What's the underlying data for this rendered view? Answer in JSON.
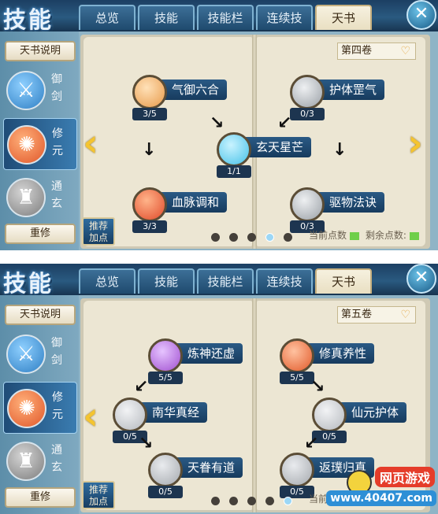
{
  "panels": [
    {
      "logo": "技能",
      "tabs": [
        "总览",
        "技能",
        "技能栏",
        "连续技",
        "天书"
      ],
      "active_tab": 4,
      "close_icon": "close-x-icon",
      "tianshu_button": "天书说明",
      "schools": [
        {
          "name": "御剑",
          "icon": "sword-emblem-icon",
          "color": "#2f7fc4"
        },
        {
          "name": "修元",
          "icon": "flame-emblem-icon",
          "color": "#e0572a"
        },
        {
          "name": "通玄",
          "icon": "pillar-emblem-icon",
          "color": "#7d7d7d"
        }
      ],
      "selected_school": 1,
      "reset_button": "重修",
      "recommend_button": [
        "推荐",
        "加点"
      ],
      "volume": "第四卷",
      "skills": [
        {
          "name": "气御六合",
          "level": "3/5",
          "color": "#e89a4a"
        },
        {
          "name": "护体罡气",
          "level": "0/3",
          "color": "#9aa0a6"
        },
        {
          "name": "玄天星芒",
          "level": "1/1",
          "color": "#45c1e8"
        },
        {
          "name": "血脉调和",
          "level": "3/3",
          "color": "#e04a2a"
        },
        {
          "name": "驱物法诀",
          "level": "0/3",
          "color": "#9aa0a6"
        }
      ],
      "pages": 5,
      "current_page": 3,
      "current_points_label": "当前点数",
      "remaining_points_label": "剩余点数:"
    },
    {
      "logo": "技能",
      "tabs": [
        "总览",
        "技能",
        "技能栏",
        "连续技",
        "天书"
      ],
      "active_tab": 4,
      "close_icon": "close-x-icon",
      "tianshu_button": "天书说明",
      "schools": [
        {
          "name": "御剑",
          "icon": "sword-emblem-icon",
          "color": "#2f7fc4"
        },
        {
          "name": "修元",
          "icon": "flame-emblem-icon",
          "color": "#e0572a"
        },
        {
          "name": "通玄",
          "icon": "pillar-emblem-icon",
          "color": "#7d7d7d"
        }
      ],
      "selected_school": 1,
      "reset_button": "重修",
      "recommend_button": [
        "推荐",
        "加点"
      ],
      "volume": "第五卷",
      "skills": [
        {
          "name": "炼神还虚",
          "level": "5/5",
          "color": "#a04fd0"
        },
        {
          "name": "修真养性",
          "level": "5/5",
          "color": "#e25a2a"
        },
        {
          "name": "南华真经",
          "level": "0/5",
          "color": "#b5b9be"
        },
        {
          "name": "仙元护体",
          "level": "0/5",
          "color": "#b5b9be"
        },
        {
          "name": "天眷有道",
          "level": "0/5",
          "color": "#a5a9ae"
        },
        {
          "name": "返璞归真",
          "level": "0/5",
          "color": "#a5a9ae"
        }
      ],
      "pages": 5,
      "current_page": 4,
      "current_points_label": "当前"
    }
  ],
  "watermark": {
    "top": "网页游戏",
    "bottom": "www.40407.com"
  }
}
